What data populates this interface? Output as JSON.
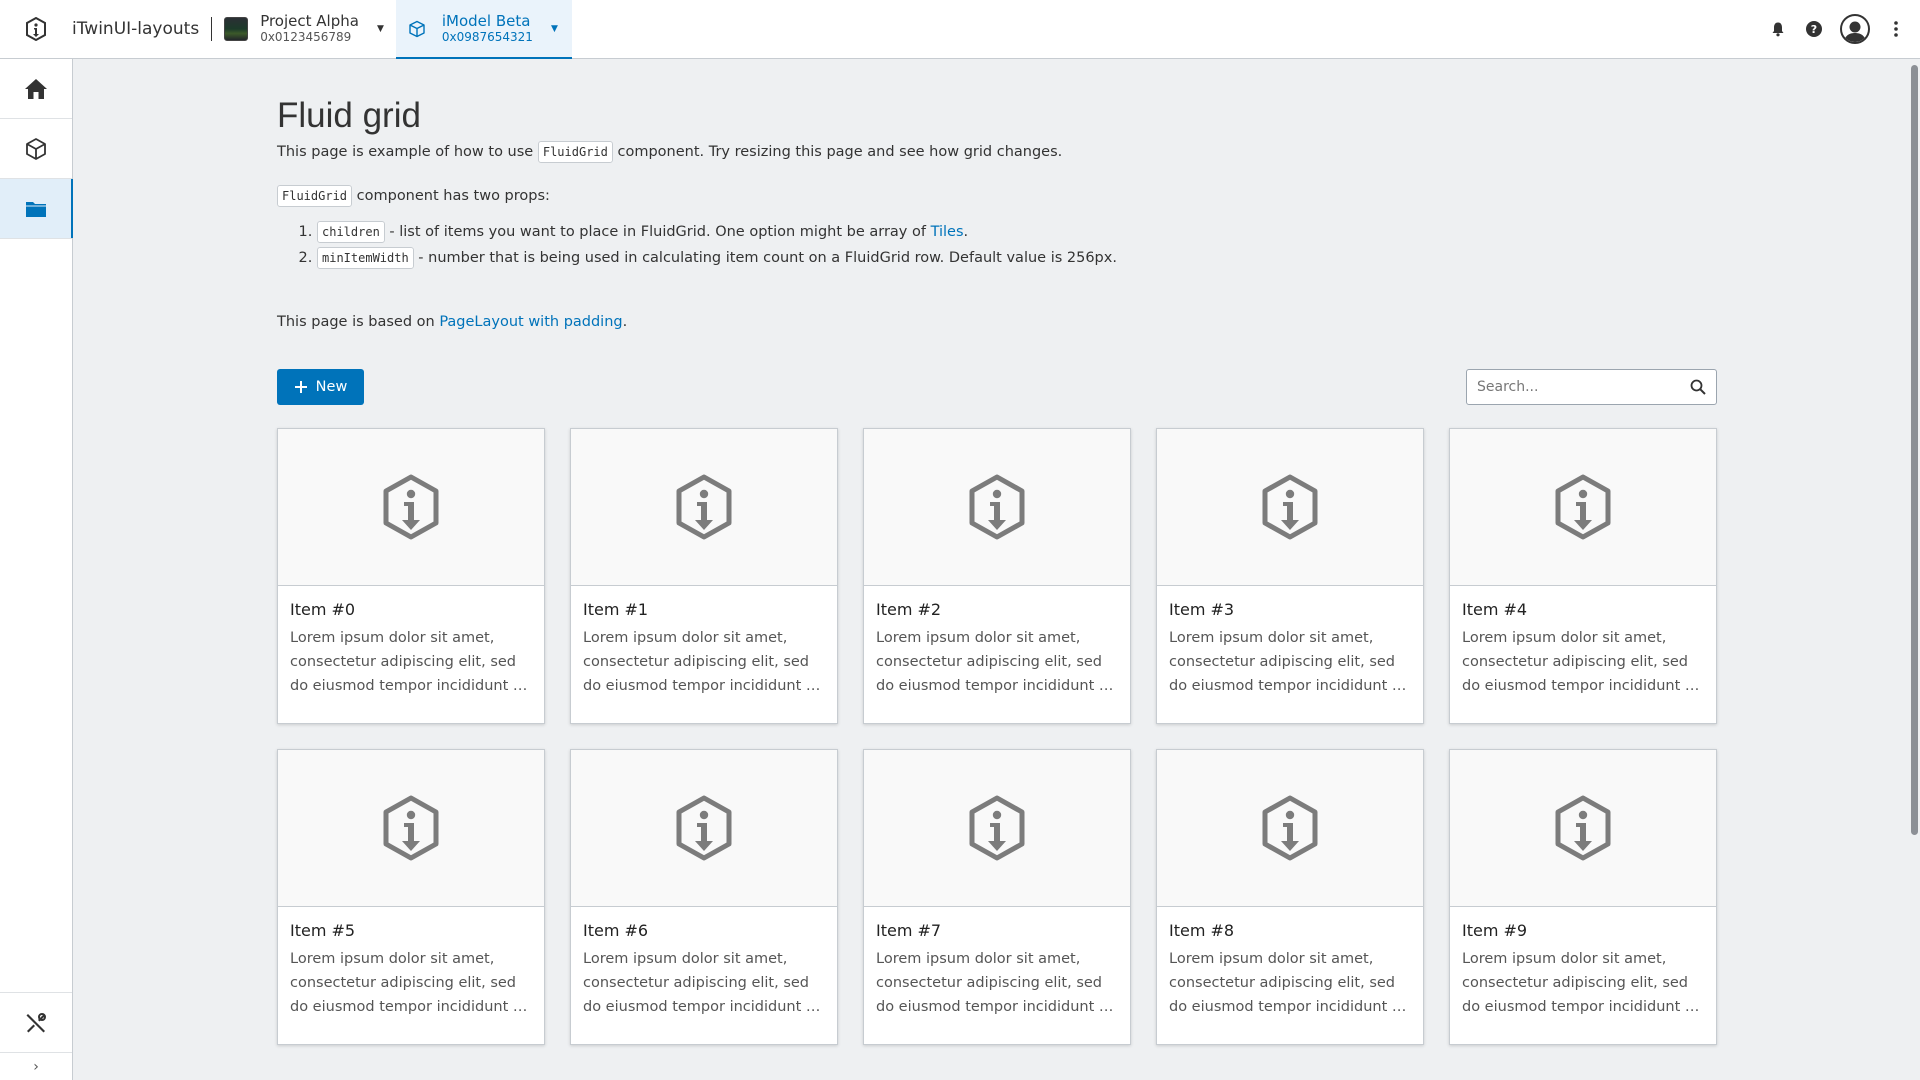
{
  "header": {
    "app_title": "iTwinUI-layouts",
    "project": {
      "name": "Project Alpha",
      "id": "0x0123456789"
    },
    "imodel": {
      "name": "iModel Beta",
      "id": "0x0987654321"
    }
  },
  "page": {
    "title": "Fluid grid",
    "desc_pre": "This page is example of how to use ",
    "desc_code": "FluidGrid",
    "desc_post": " component. Try resizing this page and see how grid changes.",
    "props_code": "FluidGrid",
    "props_text": " component has two props:",
    "prop1_code": "children",
    "prop1_text": " - list of items you want to place in FluidGrid. One option might be array of ",
    "prop1_link": "Tiles",
    "prop1_end": ".",
    "prop2_code": "minItemWidth",
    "prop2_text": " - number that is being used in calculating item count on a FluidGrid row. Default value is 256px.",
    "based_pre": "This page is based on ",
    "based_link": "PageLayout with padding",
    "based_end": "."
  },
  "toolbar": {
    "new_label": "New",
    "search_placeholder": "Search..."
  },
  "tiles": [
    {
      "name": "Item #0",
      "desc": "Lorem ipsum dolor sit amet, consectetur adipiscing elit, sed do eiusmod tempor incididunt ut labore et dolore magna aliqua."
    },
    {
      "name": "Item #1",
      "desc": "Lorem ipsum dolor sit amet, consectetur adipiscing elit, sed do eiusmod tempor incididunt ut labore et dolore magna aliqua."
    },
    {
      "name": "Item #2",
      "desc": "Lorem ipsum dolor sit amet, consectetur adipiscing elit, sed do eiusmod tempor incididunt ut labore et dolore magna aliqua."
    },
    {
      "name": "Item #3",
      "desc": "Lorem ipsum dolor sit amet, consectetur adipiscing elit, sed do eiusmod tempor incididunt ut labore et dolore magna aliqua."
    },
    {
      "name": "Item #4",
      "desc": "Lorem ipsum dolor sit amet, consectetur adipiscing elit, sed do eiusmod tempor incididunt ut labore et dolore magna aliqua."
    },
    {
      "name": "Item #5",
      "desc": "Lorem ipsum dolor sit amet, consectetur adipiscing elit, sed do eiusmod tempor incididunt ut labore et dolore magna aliqua."
    },
    {
      "name": "Item #6",
      "desc": "Lorem ipsum dolor sit amet, consectetur adipiscing elit, sed do eiusmod tempor incididunt ut labore et dolore magna aliqua."
    },
    {
      "name": "Item #7",
      "desc": "Lorem ipsum dolor sit amet, consectetur adipiscing elit, sed do eiusmod tempor incididunt ut labore et dolore magna aliqua."
    },
    {
      "name": "Item #8",
      "desc": "Lorem ipsum dolor sit amet, consectetur adipiscing elit, sed do eiusmod tempor incididunt ut labore et dolore magna aliqua."
    },
    {
      "name": "Item #9",
      "desc": "Lorem ipsum dolor sit amet, consectetur adipiscing elit, sed do eiusmod tempor incididunt ut labore et dolore magna aliqua."
    }
  ],
  "icons": {
    "logo": "itwin-info-icon",
    "nav": [
      "home-icon",
      "imodel-cube-icon",
      "folder-icon"
    ],
    "nav_bottom": "tools-icon",
    "tile": "info-hexagon-icon"
  },
  "colors": {
    "accent": "#0073ba",
    "background": "#eef0f2"
  }
}
